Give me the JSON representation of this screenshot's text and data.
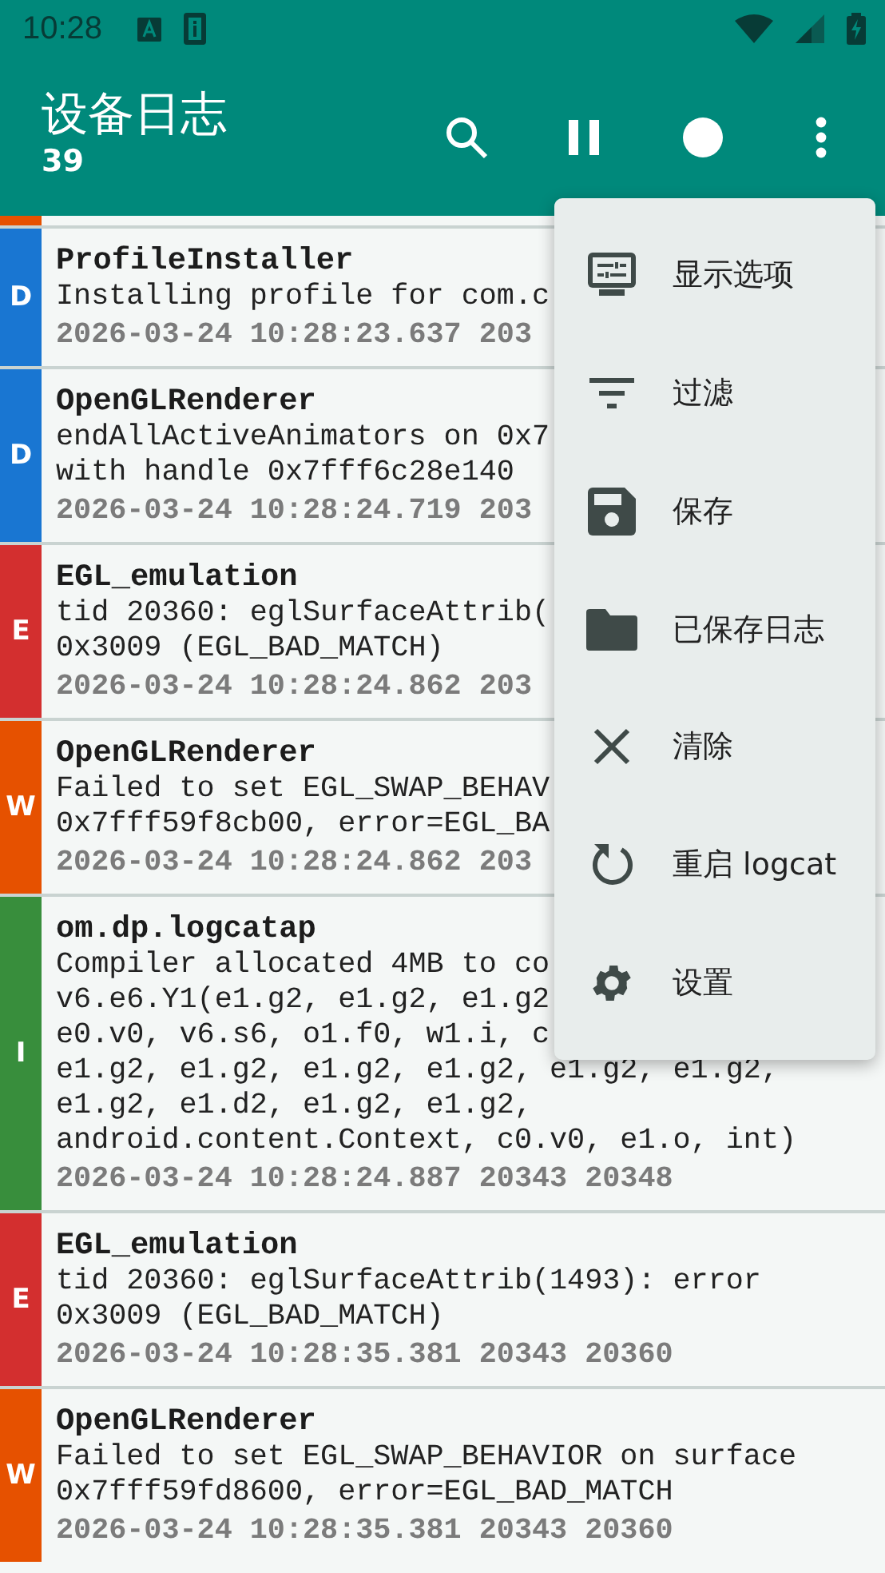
{
  "status_bar": {
    "time": "10:28"
  },
  "app_bar": {
    "title": "设备日志",
    "count": "39"
  },
  "rows": [
    {
      "kind": "cut",
      "color": "#e65100"
    },
    {
      "kind": "entry",
      "level": "D",
      "color": "#1976d2",
      "tag": "ProfileInstaller",
      "lines": [
        "Installing profile for com.c"
      ],
      "meta": "2026-03-24 10:28:23.637 203"
    },
    {
      "kind": "entry",
      "level": "D",
      "color": "#1976d2",
      "tag": "OpenGLRenderer",
      "lines": [
        "endAllActiveAnimators on 0x7",
        "with handle 0x7fff6c28e140"
      ],
      "meta": "2026-03-24 10:28:24.719 203"
    },
    {
      "kind": "entry",
      "level": "E",
      "color": "#d32f2f",
      "tag": "EGL_emulation",
      "lines": [
        "tid 20360: eglSurfaceAttrib(",
        "0x3009 (EGL_BAD_MATCH)"
      ],
      "meta": "2026-03-24 10:28:24.862 203"
    },
    {
      "kind": "entry",
      "level": "W",
      "color": "#e65100",
      "tag": "OpenGLRenderer",
      "lines": [
        "Failed to set EGL_SWAP_BEHAV",
        "0x7fff59f8cb00, error=EGL_BA"
      ],
      "meta": "2026-03-24 10:28:24.862 203"
    },
    {
      "kind": "entry",
      "level": "I",
      "color": "#388e3c",
      "tag": "om.dp.logcatap",
      "lines": [
        "Compiler allocated 4MB to co",
        "v6.e6.Y1(e1.g2, e1.g2, e1.g2",
        "e0.v0, v6.s6, o1.f0, w1.i, c",
        "e1.g2, e1.g2, e1.g2, e1.g2, e1.g2, e1.g2,",
        "e1.g2, e1.d2, e1.g2, e1.g2,",
        "android.content.Context, c0.v0, e1.o, int)"
      ],
      "meta": "2026-03-24 10:28:24.887 20343 20348"
    },
    {
      "kind": "entry",
      "level": "E",
      "color": "#d32f2f",
      "tag": "EGL_emulation",
      "lines": [
        "tid 20360: eglSurfaceAttrib(1493): error",
        "0x3009 (EGL_BAD_MATCH)"
      ],
      "meta": "2026-03-24 10:28:35.381 20343 20360"
    },
    {
      "kind": "entry",
      "level": "W",
      "color": "#e65100",
      "tag": "OpenGLRenderer",
      "lines": [
        "Failed to set EGL_SWAP_BEHAVIOR on surface",
        "0x7fff59fd8600, error=EGL_BAD_MATCH"
      ],
      "meta": "2026-03-24 10:28:35.381 20343 20360"
    }
  ],
  "menu": [
    {
      "kind": "display",
      "label": "显示选项"
    },
    {
      "kind": "filter",
      "label": "过滤"
    },
    {
      "kind": "save",
      "label": "保存"
    },
    {
      "kind": "folder",
      "label": "已保存日志"
    },
    {
      "kind": "clear",
      "label": "清除"
    },
    {
      "kind": "restart",
      "label": "重启 logcat"
    },
    {
      "kind": "settings",
      "label": "设置"
    }
  ]
}
